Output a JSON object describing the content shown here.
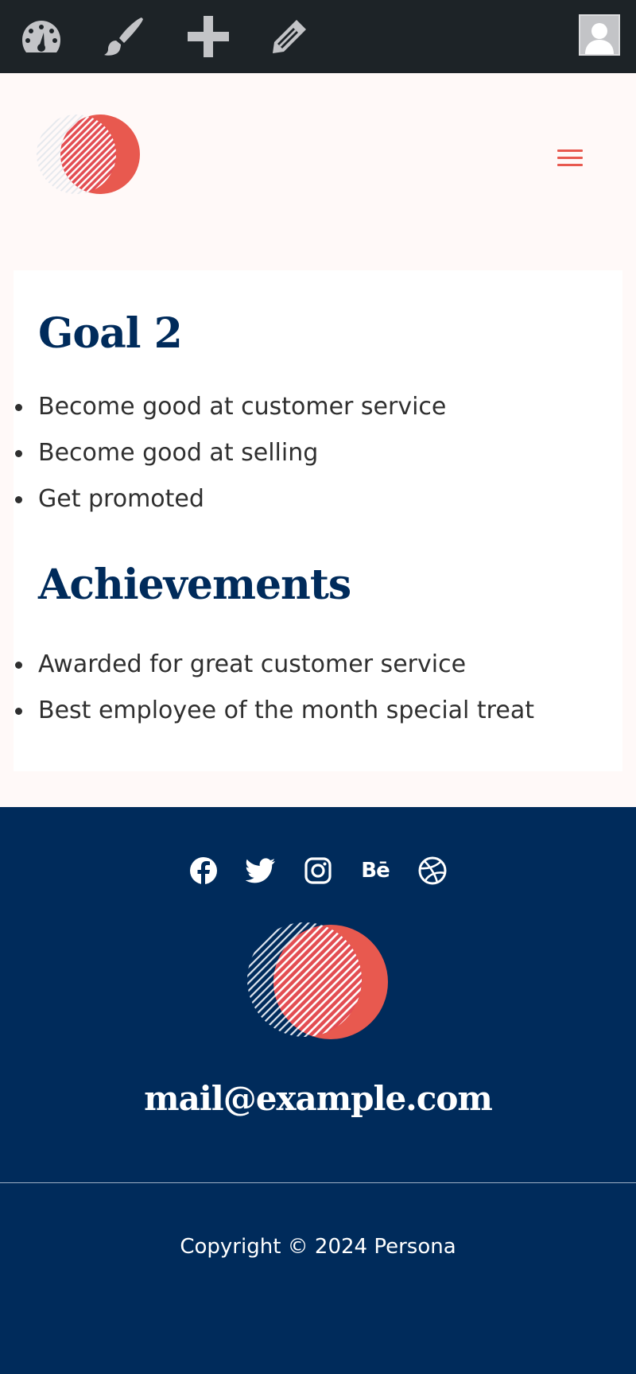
{
  "admin_bar": {
    "icons": [
      "dashboard-icon",
      "customize-brush-icon",
      "new-content-plus-icon",
      "edit-pencil-icon"
    ],
    "avatar": "user-avatar-icon",
    "background": "#1d2327",
    "icon_color": "#c3c4c7"
  },
  "header": {
    "logo": "persona-circle-logo",
    "menu_icon": "hamburger-menu-icon",
    "accent": "#e8594f"
  },
  "content": {
    "sections": [
      {
        "title": "Goal 2",
        "items": [
          "Become good at customer service",
          "Become good at selling",
          "Get promoted"
        ]
      },
      {
        "title": "Achievements",
        "items": [
          "Awarded for great customer service",
          "Best employee of the month special treat"
        ]
      }
    ],
    "heading_color": "#002b5b"
  },
  "footer": {
    "social_icons": [
      "facebook-icon",
      "twitter-icon",
      "instagram-icon",
      "behance-icon",
      "dribbble-icon"
    ],
    "behance_label": "Bē",
    "email": "mail@example.com",
    "copyright": "Copyright © 2024 Persona",
    "background": "#002b5b"
  }
}
